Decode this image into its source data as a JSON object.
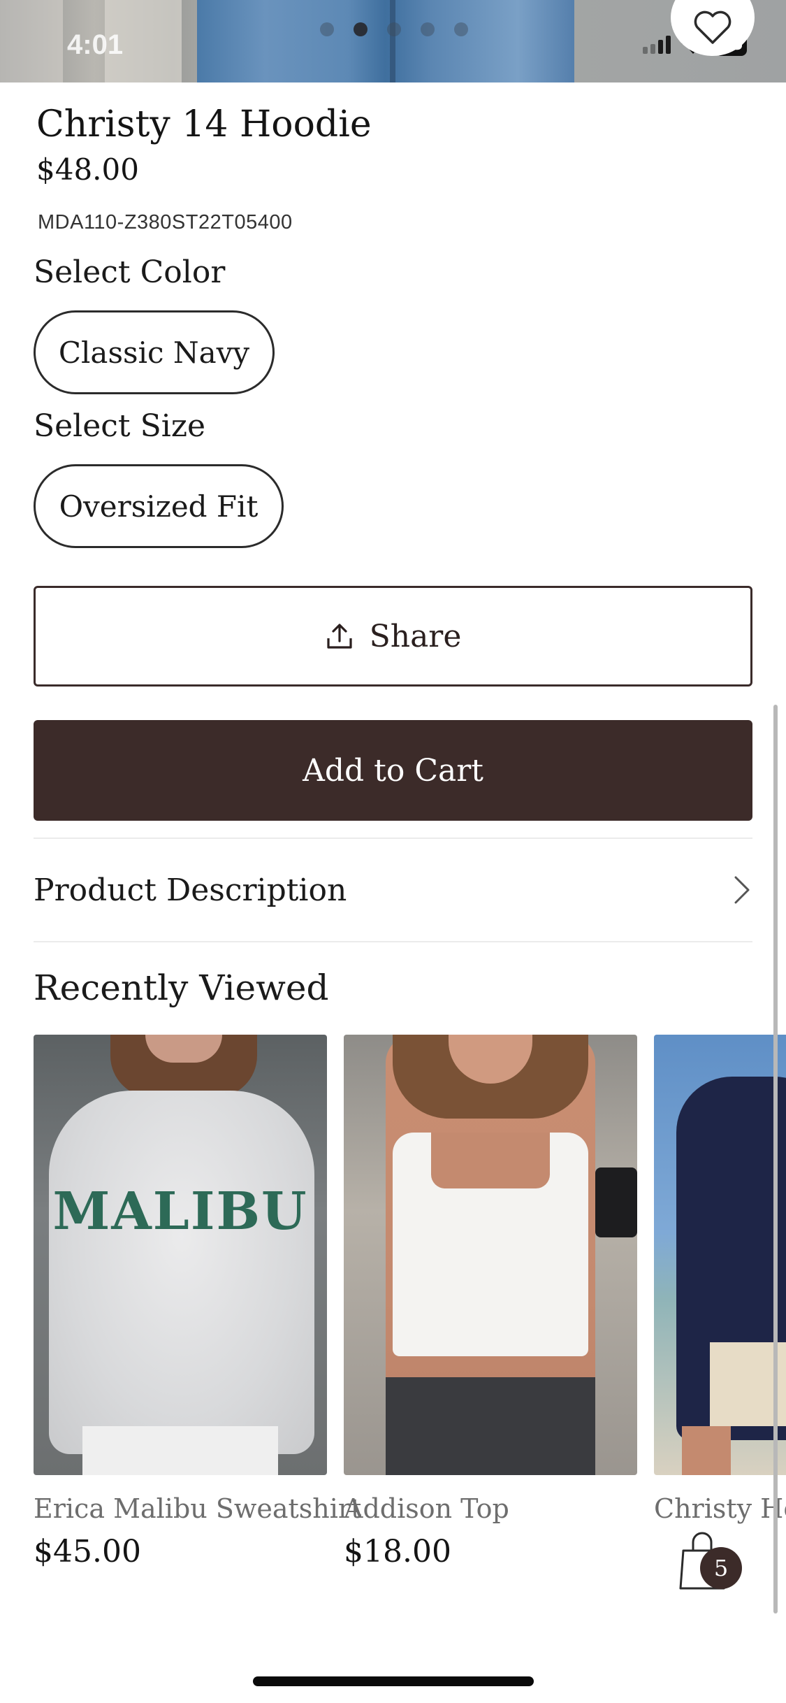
{
  "status_bar": {
    "time": "4:01",
    "battery": "58"
  },
  "hero": {
    "image_count": 5,
    "active_index": 1
  },
  "product": {
    "title": "Christy 14 Hoodie",
    "price": "$48.00",
    "sku": "MDA110-Z380ST22T05400"
  },
  "color_select": {
    "label": "Select Color",
    "selected": "Classic Navy"
  },
  "size_select": {
    "label": "Select Size",
    "selected": "Oversized Fit"
  },
  "actions": {
    "share_label": "Share",
    "add_to_cart_label": "Add to Cart"
  },
  "description_row": {
    "label": "Product Description"
  },
  "recently_viewed": {
    "title": "Recently Viewed",
    "items": [
      {
        "name": "Erica Malibu Sweatshirt",
        "price": "$45.00",
        "print": "MALIBU"
      },
      {
        "name": "Addison Top",
        "price": "$18.00"
      },
      {
        "name": "Christy Hoodie",
        "price": ""
      }
    ]
  },
  "cart": {
    "count": "5"
  },
  "colors": {
    "accent": "#3c2b29",
    "text": "#1a1a1a",
    "muted": "#6d6d6d"
  }
}
